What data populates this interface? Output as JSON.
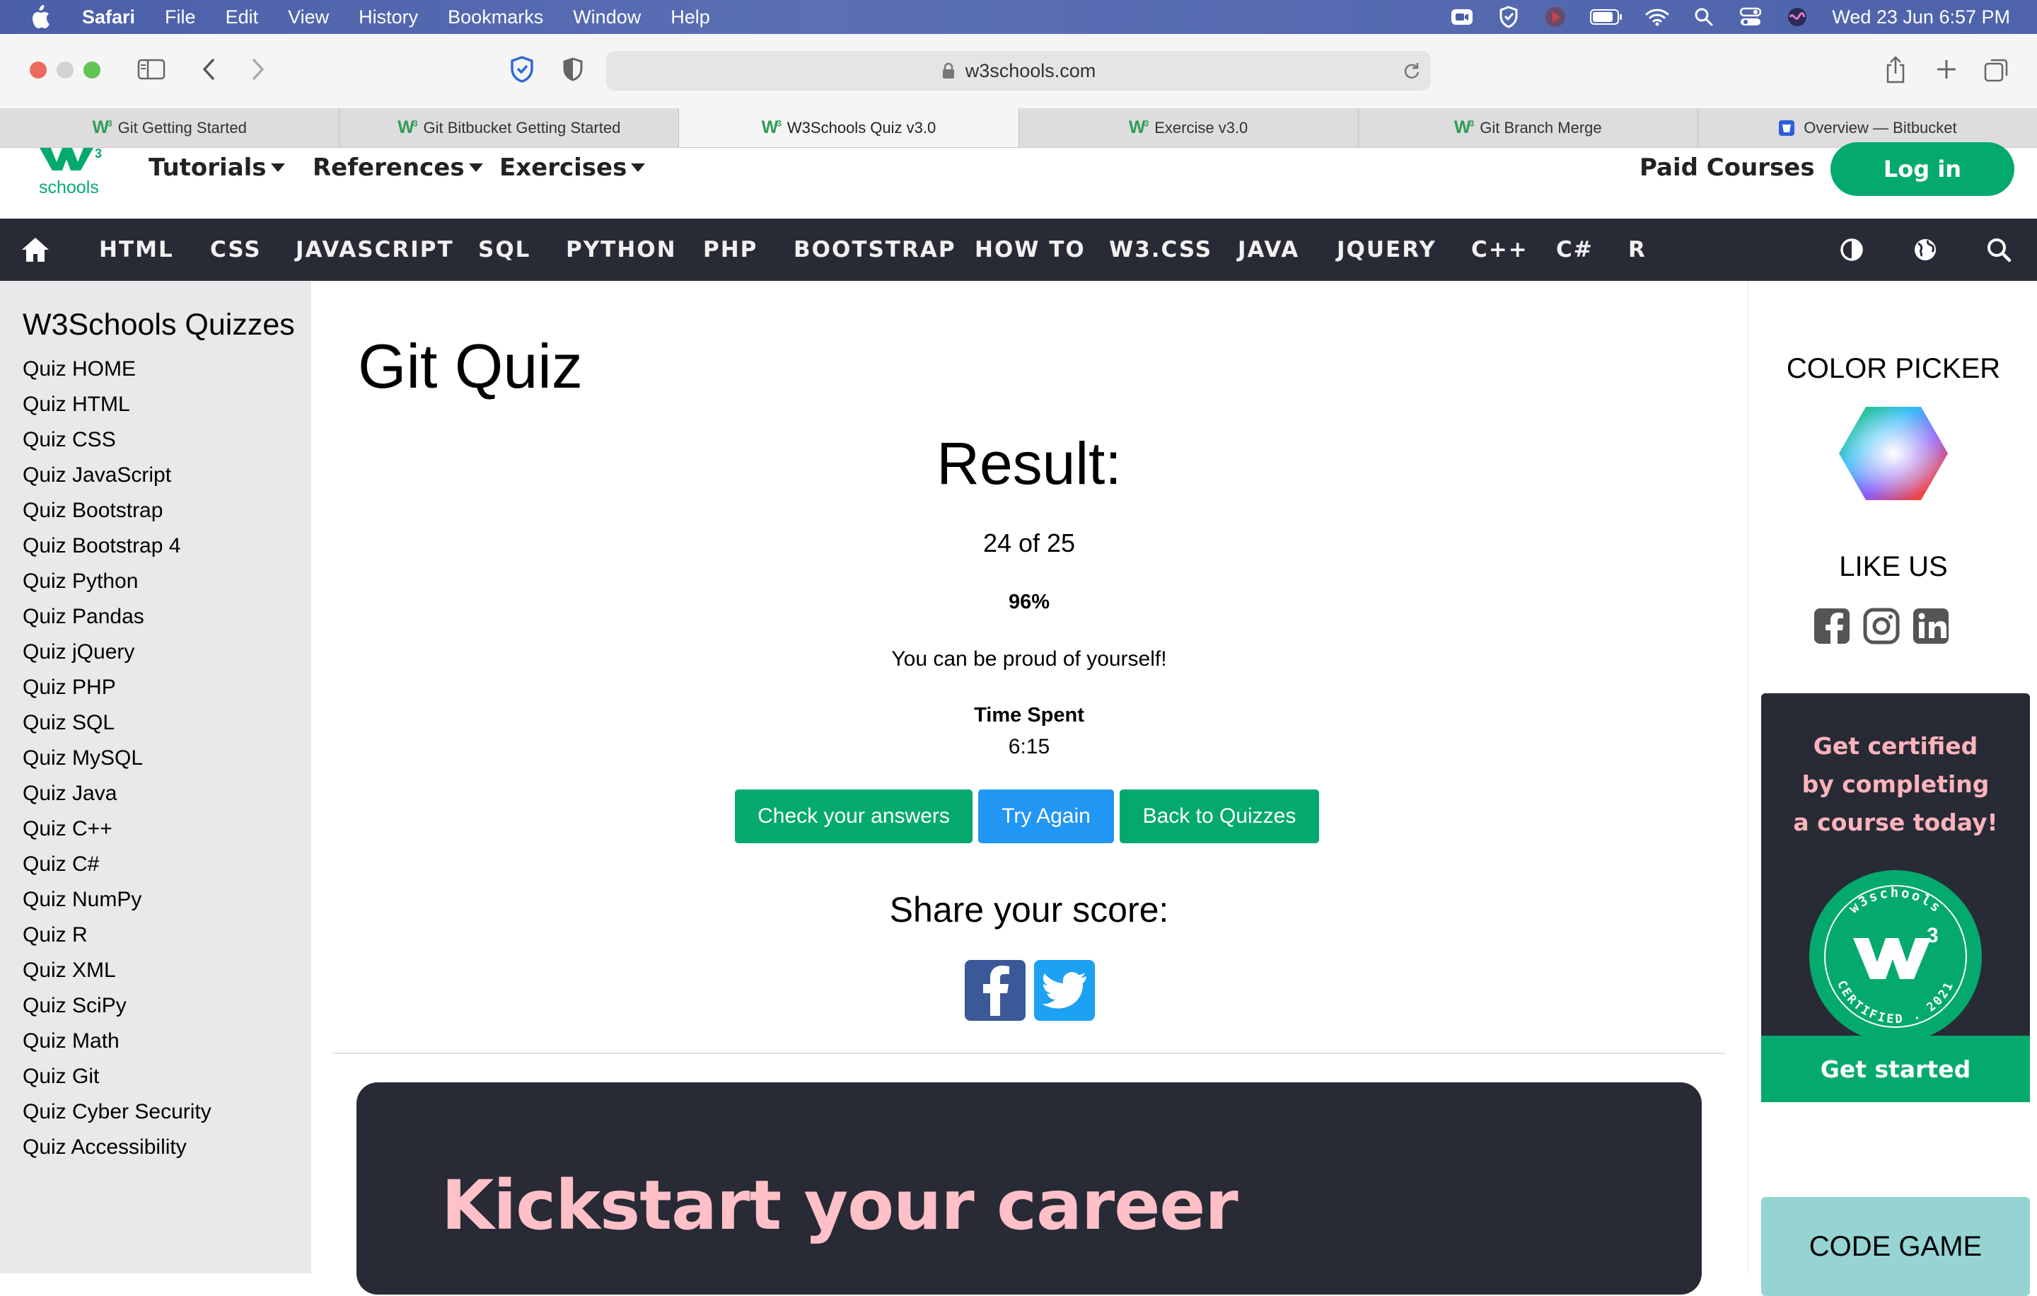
{
  "menubar": {
    "app": "Safari",
    "items": [
      "File",
      "Edit",
      "View",
      "History",
      "Bookmarks",
      "Window",
      "Help"
    ],
    "clock": "Wed 23 Jun  6:57 PM"
  },
  "browser": {
    "url": "w3schools.com",
    "tabs": [
      {
        "label": "Git Getting Started",
        "favicon": "w3"
      },
      {
        "label": "Git Bitbucket Getting Started",
        "favicon": "w3"
      },
      {
        "label": "W3Schools Quiz v3.0",
        "favicon": "w3",
        "active": true
      },
      {
        "label": "Exercise v3.0",
        "favicon": "w3"
      },
      {
        "label": "Git Branch Merge",
        "favicon": "w3"
      },
      {
        "label": "Overview — Bitbucket",
        "favicon": "bitbucket"
      }
    ]
  },
  "site": {
    "logo_text": "schools",
    "nav": {
      "tutorials": "Tutorials",
      "references": "References",
      "exercises": "Exercises",
      "paid": "Paid Courses",
      "login": "Log in"
    },
    "languages": [
      "HTML",
      "CSS",
      "JAVASCRIPT",
      "SQL",
      "PYTHON",
      "PHP",
      "BOOTSTRAP",
      "HOW TO",
      "W3.CSS",
      "JAVA",
      "JQUERY",
      "C++",
      "C#",
      "R"
    ]
  },
  "sidebar": {
    "title": "W3Schools Quizzes",
    "items": [
      "Quiz HOME",
      "Quiz HTML",
      "Quiz CSS",
      "Quiz JavaScript",
      "Quiz Bootstrap",
      "Quiz Bootstrap 4",
      "Quiz Python",
      "Quiz Pandas",
      "Quiz jQuery",
      "Quiz PHP",
      "Quiz SQL",
      "Quiz MySQL",
      "Quiz Java",
      "Quiz C++",
      "Quiz C#",
      "Quiz NumPy",
      "Quiz R",
      "Quiz XML",
      "Quiz SciPy",
      "Quiz Math",
      "Quiz Git",
      "Quiz Cyber Security",
      "Quiz Accessibility"
    ]
  },
  "main": {
    "title": "Git Quiz",
    "result_heading": "Result:",
    "score": "24 of 25",
    "percent": "96%",
    "message": "You can be proud of yourself!",
    "time_label": "Time Spent",
    "time_value": "6:15",
    "buttons": {
      "check": "Check your answers",
      "again": "Try Again",
      "back": "Back to Quizzes"
    },
    "share_heading": "Share your score:",
    "promo_text": "Kickstart your career"
  },
  "right": {
    "color_picker": "COLOR PICKER",
    "like_us": "LIKE US",
    "cert_lines": [
      "Get certified",
      "by completing",
      "a course today!"
    ],
    "badge_top": "w3schools",
    "badge_bottom": "CERTIFIED . 2021",
    "get_started": "Get started",
    "code_game": "CODE GAME"
  },
  "colors": {
    "brand_green": "#04aa6d",
    "dark_bar": "#282a35",
    "button_blue": "#2196f3",
    "sidebar_bg": "#e7e9eb",
    "pink_text": "#ffc0c7"
  }
}
